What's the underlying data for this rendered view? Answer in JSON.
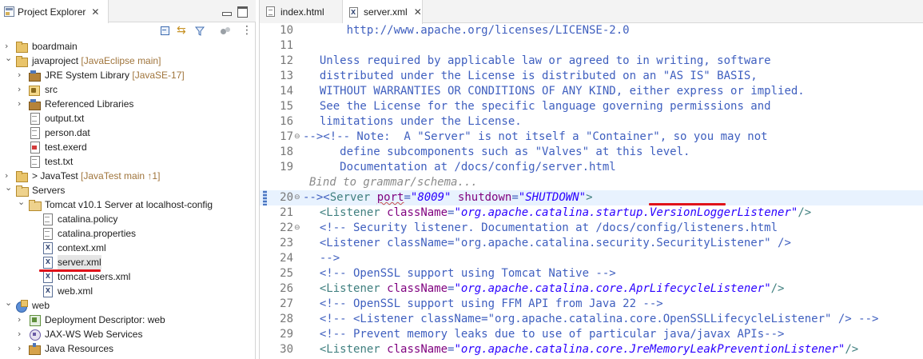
{
  "project_explorer": {
    "title": "Project Explorer",
    "tree": [
      {
        "level": 0,
        "expanded": false,
        "icon": "project-icon",
        "label": "boardmain",
        "decor": ""
      },
      {
        "level": 0,
        "expanded": true,
        "icon": "project-icon",
        "label": "javaproject",
        "decor": "[JavaEclipse main]"
      },
      {
        "level": 1,
        "expanded": false,
        "icon": "library-icon",
        "label": "JRE System Library",
        "decor": "[JavaSE-17]"
      },
      {
        "level": 1,
        "expanded": false,
        "icon": "source-folder-icon",
        "label": "src",
        "decor": ""
      },
      {
        "level": 1,
        "expanded": false,
        "icon": "library-icon",
        "label": "Referenced Libraries",
        "decor": ""
      },
      {
        "level": 1,
        "expanded": null,
        "icon": "text-file-icon",
        "label": "output.txt",
        "decor": ""
      },
      {
        "level": 1,
        "expanded": null,
        "icon": "text-file-icon",
        "label": "person.dat",
        "decor": ""
      },
      {
        "level": 1,
        "expanded": null,
        "icon": "exerd-file-icon",
        "label": "test.exerd",
        "decor": ""
      },
      {
        "level": 1,
        "expanded": null,
        "icon": "text-file-icon",
        "label": "test.txt",
        "decor": ""
      },
      {
        "level": 0,
        "expanded": false,
        "icon": "project-icon",
        "label": "> JavaTest",
        "decor": "[JavaTest main ↑1]"
      },
      {
        "level": 0,
        "expanded": true,
        "icon": "folder-icon",
        "label": "Servers",
        "decor": ""
      },
      {
        "level": 1,
        "expanded": true,
        "icon": "folder-icon",
        "label": "Tomcat v10.1 Server at localhost-config",
        "decor": ""
      },
      {
        "level": 2,
        "expanded": null,
        "icon": "text-file-icon",
        "label": "catalina.policy",
        "decor": ""
      },
      {
        "level": 2,
        "expanded": null,
        "icon": "text-file-icon",
        "label": "catalina.properties",
        "decor": ""
      },
      {
        "level": 2,
        "expanded": null,
        "icon": "xml-file-icon",
        "label": "context.xml",
        "decor": ""
      },
      {
        "level": 2,
        "expanded": null,
        "icon": "xml-file-icon",
        "label": "server.xml",
        "decor": "",
        "selected": true
      },
      {
        "level": 2,
        "expanded": null,
        "icon": "xml-file-icon",
        "label": "tomcat-users.xml",
        "decor": ""
      },
      {
        "level": 2,
        "expanded": null,
        "icon": "xml-file-icon",
        "label": "web.xml",
        "decor": ""
      },
      {
        "level": 0,
        "expanded": true,
        "icon": "web-project-icon",
        "label": "web",
        "decor": ""
      },
      {
        "level": 1,
        "expanded": false,
        "icon": "deployment-descriptor-icon",
        "label": "Deployment Descriptor: web",
        "decor": ""
      },
      {
        "level": 1,
        "expanded": false,
        "icon": "web-services-icon",
        "label": "JAX-WS Web Services",
        "decor": ""
      },
      {
        "level": 1,
        "expanded": false,
        "icon": "java-resources-icon",
        "label": "Java Resources",
        "decor": ""
      }
    ]
  },
  "editor": {
    "tabs": [
      {
        "label": "index.html",
        "active": false
      },
      {
        "label": "server.xml",
        "active": true
      }
    ],
    "grammar_hint": "Bind to grammar/schema...",
    "lines": [
      {
        "n": "10",
        "fold": "",
        "text": "      http://www.apache.org/licenses/LICENSE-2.0"
      },
      {
        "n": "11",
        "fold": "",
        "text": ""
      },
      {
        "n": "12",
        "fold": "",
        "text": "  Unless required by applicable law or agreed to in writing, software"
      },
      {
        "n": "13",
        "fold": "",
        "text": "  distributed under the License is distributed on an \"AS IS\" BASIS,"
      },
      {
        "n": "14",
        "fold": "",
        "text": "  WITHOUT WARRANTIES OR CONDITIONS OF ANY KIND, either express or implied."
      },
      {
        "n": "15",
        "fold": "",
        "text": "  See the License for the specific language governing permissions and"
      },
      {
        "n": "16",
        "fold": "",
        "text": "  limitations under the License."
      },
      {
        "n": "17",
        "fold": "⊖",
        "text": "--><!-- Note:  A \"Server\" is not itself a \"Container\", so you may not"
      },
      {
        "n": "18",
        "fold": "",
        "text": "     define subcomponents such as \"Valves\" at this level."
      },
      {
        "n": "19",
        "fold": "",
        "text": "     Documentation at /docs/config/server.html"
      },
      {
        "n": "20",
        "fold": "⊖",
        "segments": [
          {
            "t": "--><",
            "c": "cmt"
          },
          {
            "t": "Server",
            "c": "tag-n"
          },
          {
            "t": " ",
            "c": ""
          },
          {
            "t": "port",
            "c": "attr-n"
          },
          {
            "t": "=",
            "c": ""
          },
          {
            "t": "\"8009\"",
            "c": "attr-v"
          },
          {
            "t": " ",
            "c": ""
          },
          {
            "t": "shutdown",
            "c": "attr-n"
          },
          {
            "t": "=",
            "c": ""
          },
          {
            "t": "\"SHUTDOWN\"",
            "c": "attr-v"
          },
          {
            "t": ">",
            "c": "tag-n"
          }
        ]
      },
      {
        "n": "21",
        "fold": "",
        "segments": [
          {
            "t": "  <",
            "c": "tag-n"
          },
          {
            "t": "Listener",
            "c": "tag-n"
          },
          {
            "t": " ",
            "c": ""
          },
          {
            "t": "className",
            "c": "attr-n"
          },
          {
            "t": "=",
            "c": ""
          },
          {
            "t": "\"org.apache.catalina.startup.VersionLoggerListener\"",
            "c": "attr-v"
          },
          {
            "t": "/>",
            "c": "tag-n"
          }
        ]
      },
      {
        "n": "22",
        "fold": "⊖",
        "text": "  <!-- Security listener. Documentation at /docs/config/listeners.html"
      },
      {
        "n": "23",
        "fold": "",
        "text": "  <Listener className=\"org.apache.catalina.security.SecurityListener\" />"
      },
      {
        "n": "24",
        "fold": "",
        "text": "  -->"
      },
      {
        "n": "25",
        "fold": "",
        "text": "  <!-- OpenSSL support using Tomcat Native -->"
      },
      {
        "n": "26",
        "fold": "",
        "segments": [
          {
            "t": "  <",
            "c": "tag-n"
          },
          {
            "t": "Listener",
            "c": "tag-n"
          },
          {
            "t": " ",
            "c": ""
          },
          {
            "t": "className",
            "c": "attr-n"
          },
          {
            "t": "=",
            "c": ""
          },
          {
            "t": "\"org.apache.catalina.core.AprLifecycleListener\"",
            "c": "attr-v"
          },
          {
            "t": "/>",
            "c": "tag-n"
          }
        ]
      },
      {
        "n": "27",
        "fold": "",
        "text": "  <!-- OpenSSL support using FFM API from Java 22 -->"
      },
      {
        "n": "28",
        "fold": "",
        "text": "  <!-- <Listener className=\"org.apache.catalina.core.OpenSSLLifecycleListener\" /> -->"
      },
      {
        "n": "29",
        "fold": "",
        "text": "  <!-- Prevent memory leaks due to use of particular java/javax APIs-->"
      },
      {
        "n": "30",
        "fold": "",
        "segments": [
          {
            "t": "  <",
            "c": "tag-n"
          },
          {
            "t": "Listener",
            "c": "tag-n"
          },
          {
            "t": " ",
            "c": ""
          },
          {
            "t": "className",
            "c": "attr-n"
          },
          {
            "t": "=",
            "c": ""
          },
          {
            "t": "\"org.apache.catalina.core.JreMemoryLeakPreventionListener\"",
            "c": "attr-v"
          },
          {
            "t": "/>",
            "c": "tag-n"
          }
        ]
      }
    ]
  },
  "colors": {
    "annotation_red": "#e0121a",
    "comment_blue": "#3f5fbf",
    "tag_teal": "#3f7f7f",
    "attr_purple": "#7f007f",
    "value_blue": "#2a00ff",
    "current_line": "#e8f2fe"
  }
}
